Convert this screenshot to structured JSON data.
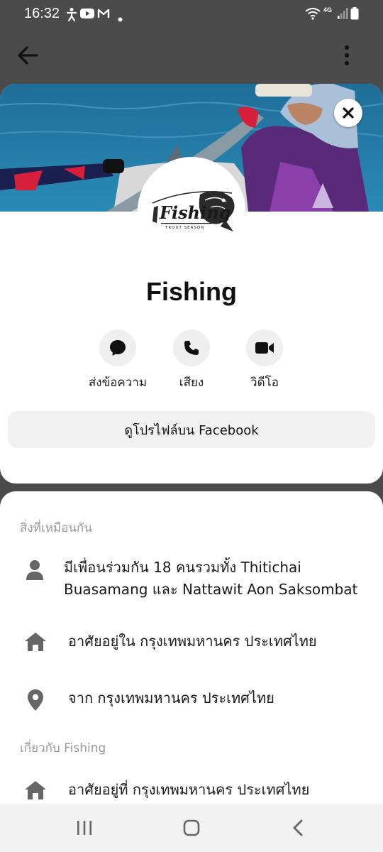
{
  "status_bar": {
    "time": "16:32",
    "network_label": "4G",
    "icons": [
      "accessibility-icon",
      "youtube-icon",
      "gmail-icon",
      "dot-icon",
      "wifi-icon",
      "signal-icon",
      "battery-icon"
    ]
  },
  "topbar": {
    "icons": [
      "back-arrow-icon",
      "more-vertical-icon"
    ]
  },
  "profile": {
    "name": "Fishing",
    "logo_text": "Fishing",
    "logo_tagline": "TROUT SEASON"
  },
  "actions": [
    {
      "label": "ส่งข้อความ",
      "icon": "messenger-icon"
    },
    {
      "label": "เสียง",
      "icon": "phone-icon"
    },
    {
      "label": "วิดีโอ",
      "icon": "video-icon"
    }
  ],
  "view_profile_button": "ดูโปรไฟล์บน Facebook",
  "common_section": {
    "title": "สิ่งที่เหมือนกัน",
    "rows": [
      {
        "icon": "person-icon",
        "text": "มีเพื่อนร่วมกัน 18 คนรวมทั้ง Thitichai Buasamang และ Nattawit Aon Saksombat"
      },
      {
        "icon": "home-icon",
        "text": "อาศัยอยู่ใน กรุงเทพมหานคร ประเทศไทย"
      },
      {
        "icon": "location-pin-icon",
        "text": "จาก กรุงเทพมหานคร ประเทศไทย"
      }
    ]
  },
  "about_section": {
    "title": "เกี่ยวกับ Fishing",
    "rows": [
      {
        "icon": "home-icon",
        "text": "อาศัยอยู่ที่ กรุงเทพมหานคร ประเทศไทย"
      }
    ]
  },
  "colors": {
    "background_dim": "#4b4b4b",
    "card": "#ffffff",
    "icon_gray": "#666666",
    "muted_text": "#999999",
    "button_bg": "#f1f1f1"
  },
  "navbar": {
    "icons": [
      "recent-apps-icon",
      "home-nav-icon",
      "back-nav-icon"
    ]
  }
}
